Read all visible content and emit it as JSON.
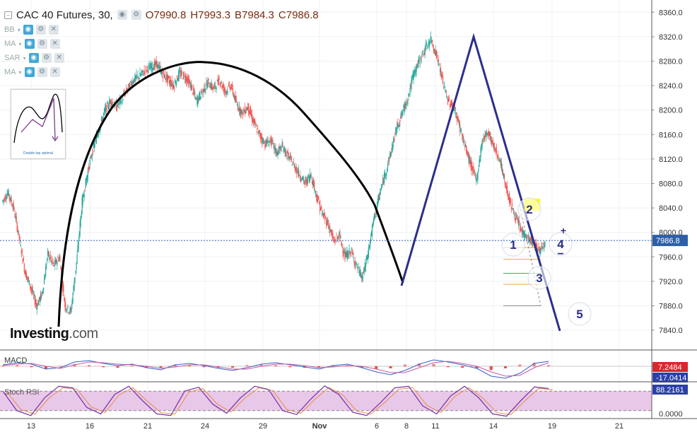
{
  "header": {
    "symbol": "CAC 40 Futures, 30,",
    "open": "O7990.8",
    "high": "H7993.3",
    "low": "B7984.3",
    "close": "C7986.8"
  },
  "indicators": [
    {
      "label": "BB"
    },
    {
      "label": "MA"
    },
    {
      "label": "SAR"
    },
    {
      "label": "MA"
    }
  ],
  "thumbnail": {
    "caption": "Double top optimal"
  },
  "logo": {
    "main": "Investing",
    "suffix": ".com"
  },
  "colors": {
    "up": "#26a69a",
    "down": "#ef5350",
    "cup": "#000000",
    "trend": "#2c2e8c",
    "last_price_bg": "#2c5fa8",
    "macd_bg": "#d9262e",
    "rsi_fill": "#e8c8e8",
    "highlight": "#ffff00"
  },
  "chart_data": [
    {
      "type": "candlestick",
      "title": "CAC 40 Futures, 30,",
      "x_tick_labels": [
        "13",
        "16",
        "21",
        "24",
        "29",
        "Nov",
        "6",
        "8",
        "11",
        "14",
        "19",
        "21"
      ],
      "y_tick_labels": [
        "8360.0",
        "8320.0",
        "8280.0",
        "8240.0",
        "8200.0",
        "8160.0",
        "8120.0",
        "8080.0",
        "8040.0",
        "8000.0",
        "7960.0",
        "7920.0",
        "7880.0",
        "7840.0"
      ],
      "ylim": [
        7810,
        8380
      ],
      "last_price": "7986.8",
      "close_series": [
        8050,
        8065,
        8040,
        7990,
        7935,
        7910,
        7880,
        7900,
        7965,
        7945,
        7960,
        7880,
        7870,
        7950,
        8050,
        8100,
        8140,
        8170,
        8200,
        8215,
        8205,
        8220,
        8235,
        8250,
        8255,
        8265,
        8270,
        8275,
        8260,
        8250,
        8240,
        8260,
        8255,
        8240,
        8215,
        8230,
        8245,
        8235,
        8250,
        8230,
        8240,
        8210,
        8195,
        8205,
        8180,
        8160,
        8145,
        8150,
        8130,
        8140,
        8125,
        8110,
        8095,
        8080,
        8095,
        8060,
        8030,
        8015,
        7985,
        7995,
        7960,
        7970,
        7945,
        7925,
        7965,
        8020,
        8060,
        8095,
        8130,
        8170,
        8195,
        8220,
        8260,
        8280,
        8300,
        8315,
        8290,
        8250,
        8215,
        8205,
        8175,
        8140,
        8110,
        8085,
        8150,
        8165,
        8140,
        8120,
        8080,
        8045,
        8020,
        8000,
        7990,
        7980,
        7970,
        7985
      ],
      "annotations": [
        "1",
        "2",
        "3",
        "4",
        "5",
        "+",
        "−"
      ]
    },
    {
      "type": "line",
      "title": "MACD",
      "values_label": [
        "7.2484",
        "-17.0414"
      ],
      "series": [
        {
          "values": [
            2,
            5,
            3,
            -4,
            -2,
            6,
            8,
            4,
            1,
            3,
            -2,
            -5,
            2,
            4,
            1,
            -3,
            -6,
            -2,
            3,
            5,
            2,
            -1,
            -4,
            1,
            3,
            -2,
            -8,
            -12,
            -6,
            3,
            9,
            6,
            2,
            -3,
            -14,
            -17,
            -10,
            4,
            7
          ]
        },
        {
          "values": [
            1,
            3,
            4,
            0,
            -3,
            2,
            6,
            5,
            3,
            2,
            0,
            -3,
            -1,
            2,
            2,
            -1,
            -4,
            -4,
            0,
            3,
            3,
            1,
            -2,
            -1,
            1,
            0,
            -4,
            -9,
            -9,
            -2,
            5,
            7,
            4,
            0,
            -8,
            -14,
            -13,
            -2,
            5
          ]
        }
      ]
    },
    {
      "type": "line",
      "title": "Stoch RSI",
      "values_label": [
        "88.2161",
        "0.0000"
      ],
      "ylim": [
        0,
        100
      ],
      "series": [
        {
          "values": [
            80,
            20,
            5,
            60,
            95,
            90,
            30,
            10,
            70,
            95,
            50,
            10,
            5,
            80,
            92,
            40,
            12,
            60,
            95,
            85,
            20,
            8,
            55,
            96,
            70,
            15,
            5,
            45,
            90,
            95,
            35,
            10,
            65,
            95,
            60,
            10,
            3,
            50,
            93,
            88
          ]
        }
      ]
    }
  ]
}
